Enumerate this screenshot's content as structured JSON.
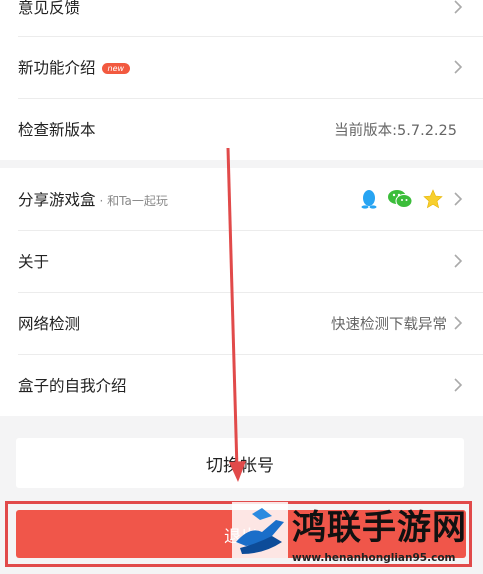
{
  "settings": {
    "feedback": {
      "label": "意见反馈"
    },
    "new_features": {
      "label": "新功能介绍",
      "badge": "new"
    },
    "check_update": {
      "label": "检查新版本",
      "value": "当前版本:5.7.2.25"
    },
    "share": {
      "label": "分享游戏盒",
      "sub": "· 和Ta一起玩",
      "icons": [
        "qq-icon",
        "wechat-icon",
        "qzone-star-icon"
      ]
    },
    "about": {
      "label": "关于"
    },
    "network": {
      "label": "网络检测",
      "value": "快速检测下载异常"
    },
    "intro": {
      "label": "盒子的自我介绍"
    }
  },
  "buttons": {
    "switch_account": "切换帐号",
    "logout": "退出"
  },
  "watermark": {
    "title": "鸿联手游网",
    "url": "www.henanhonglian95.com"
  },
  "colors": {
    "accent_red": "#f0564a",
    "highlight_frame": "#e14a4a",
    "qq_blue": "#27a4f2",
    "wechat_green": "#3bbd3a",
    "star_yellow": "#f7cf2e"
  }
}
